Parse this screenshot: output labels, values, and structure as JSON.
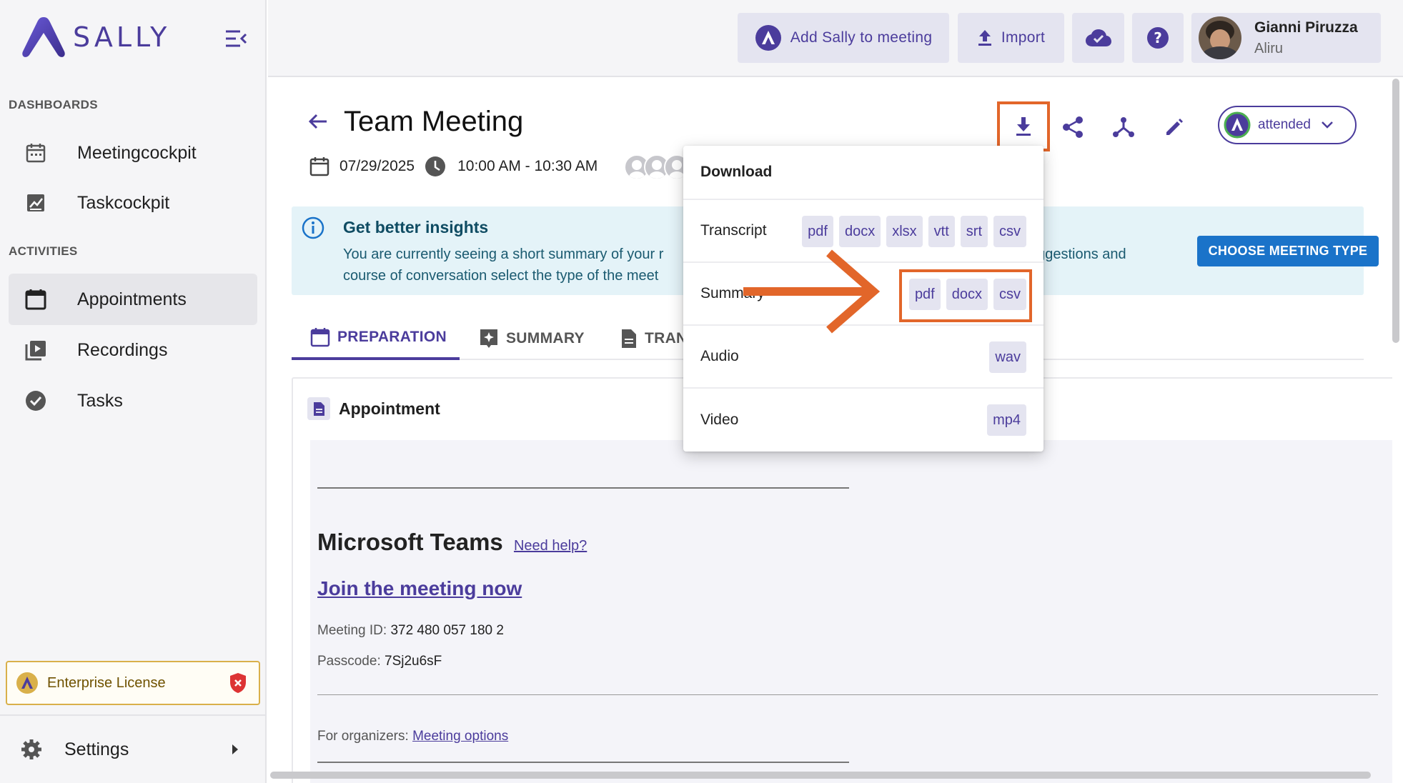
{
  "app": {
    "brand": "SALLY",
    "accent": "#4b3c9c"
  },
  "sidebar": {
    "dashboards_label": "DASHBOARDS",
    "activities_label": "ACTIVITIES",
    "items": [
      {
        "label": "Meetingcockpit",
        "icon": "calendar-icon"
      },
      {
        "label": "Taskcockpit",
        "icon": "chart-icon"
      },
      {
        "label": "Appointments",
        "icon": "calendar-icon",
        "active": true
      },
      {
        "label": "Recordings",
        "icon": "video-library-icon"
      },
      {
        "label": "Tasks",
        "icon": "check-circle-icon"
      }
    ],
    "license": "Enterprise License",
    "settings": "Settings"
  },
  "topbar": {
    "add_sally": "Add Sally to meeting",
    "import": "Import",
    "user_name": "Gianni Piruzza",
    "user_org": "Aliru"
  },
  "meeting": {
    "title": "Team Meeting",
    "date": "07/29/2025",
    "time": "10:00 AM - 10:30 AM",
    "status": "attended"
  },
  "banner": {
    "title": "Get better insights",
    "text": "You are currently seeing a short summary of your r",
    "text_end": "uggestions and",
    "text_line2": "course of conversation select the type of the meet",
    "button": "CHOOSE MEETING TYPE"
  },
  "tabs": [
    {
      "label": "PREPARATION",
      "active": true
    },
    {
      "label": "SUMMARY"
    },
    {
      "label": "TRAN"
    }
  ],
  "appointment": {
    "heading": "Appointment",
    "ms_title": "Microsoft Teams",
    "need_help": "Need help?",
    "join": "Join the meeting now",
    "meeting_id_label": "Meeting ID:",
    "meeting_id": "372 480 057 180 2",
    "passcode_label": "Passcode:",
    "passcode": "7Sj2u6sF",
    "organizers_label": "For organizers:",
    "meeting_options": "Meeting options"
  },
  "download_menu": {
    "title": "Download",
    "rows": [
      {
        "label": "Transcript",
        "formats": [
          "pdf",
          "docx",
          "xlsx",
          "vtt",
          "srt",
          "csv"
        ]
      },
      {
        "label": "Summary",
        "formats": [
          "pdf",
          "docx",
          "csv"
        ]
      },
      {
        "label": "Audio",
        "formats": [
          "wav"
        ]
      },
      {
        "label": "Video",
        "formats": [
          "mp4"
        ]
      }
    ]
  },
  "highlight_color": "#e2662a"
}
